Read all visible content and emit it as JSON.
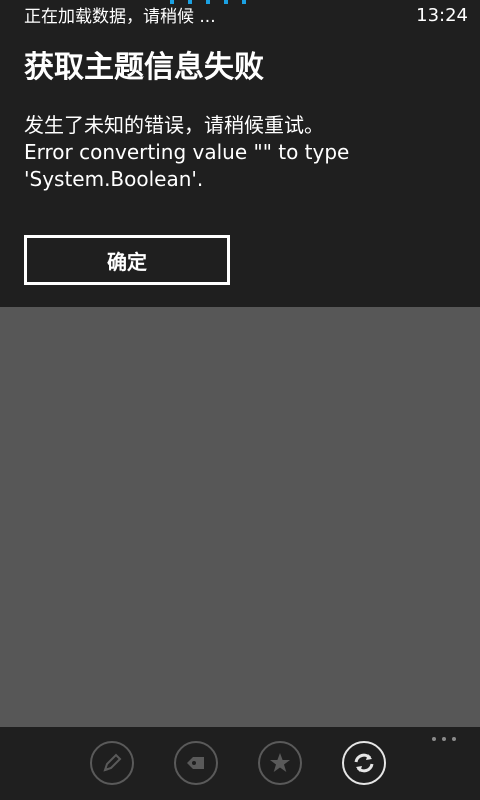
{
  "status_bar": {
    "loading_text": "正在加载数据，请稍候 ...",
    "time": "13:24",
    "accent_color": "#1ba1e2"
  },
  "dialog": {
    "title": "获取主题信息失败",
    "message_lines": [
      "发生了未知的错误，请稍候重试。",
      "Error converting value \"\" to type",
      "'System.Boolean'."
    ],
    "ok_button_label": "确定"
  },
  "app_bar": {
    "icons": [
      {
        "name": "pencil-icon",
        "enabled": false
      },
      {
        "name": "tag-icon",
        "enabled": false
      },
      {
        "name": "star-icon",
        "enabled": false
      },
      {
        "name": "refresh-icon",
        "enabled": true
      }
    ],
    "more_icon": "ellipsis-icon"
  },
  "colors": {
    "panel_background": "#1f1f1f",
    "page_background": "#575757",
    "text": "#ffffff"
  }
}
